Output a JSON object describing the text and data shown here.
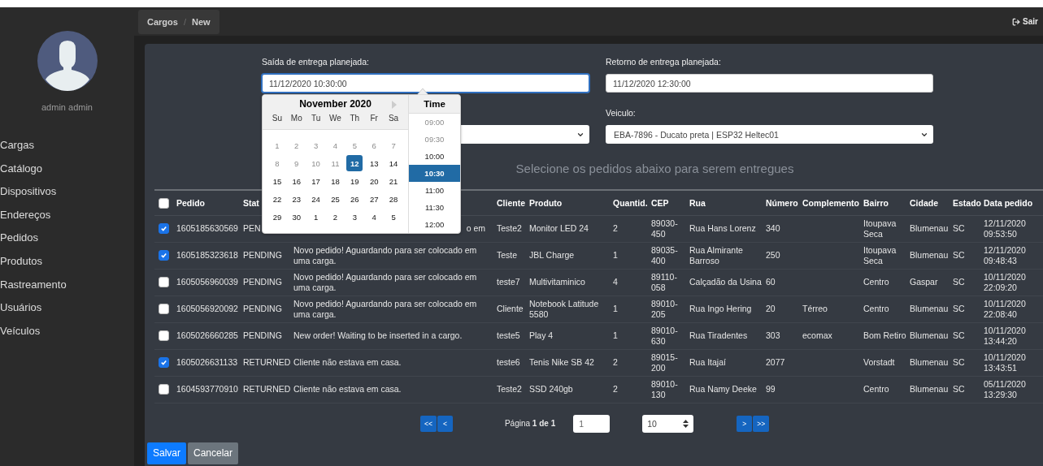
{
  "sidebar": {
    "user": "admin admin",
    "items": [
      "Cargas",
      "Catálogo",
      "Dispositivos",
      "Endereços",
      "Pedidos",
      "Produtos",
      "Rastreamento",
      "Usuários",
      "Veículos"
    ]
  },
  "topbar": {
    "breadcrumb": [
      "Cargos",
      "New"
    ],
    "separator": "/",
    "logout": "Sair"
  },
  "form": {
    "departure": {
      "label": "Saída de entrega planejada:",
      "value": "11/12/2020 10:30:00"
    },
    "return": {
      "label": "Retorno de entrega planejada:",
      "value": "11/12/2020 12:30:00"
    },
    "vehicle": {
      "label": "Veiculo:",
      "value": "EBA-7896 - Ducato preta | ESP32 Heltec01"
    }
  },
  "datepicker": {
    "month": "November 2020",
    "weekdays": [
      "Su",
      "Mo",
      "Tu",
      "We",
      "Th",
      "Fr",
      "Sa"
    ],
    "weeks": [
      [
        {
          "label": "1",
          "disabled": true,
          "selected": false
        },
        {
          "label": "2",
          "disabled": true,
          "selected": false
        },
        {
          "label": "3",
          "disabled": true,
          "selected": false
        },
        {
          "label": "4",
          "disabled": true,
          "selected": false
        },
        {
          "label": "5",
          "disabled": true,
          "selected": false
        },
        {
          "label": "6",
          "disabled": true,
          "selected": false
        },
        {
          "label": "7",
          "disabled": true,
          "selected": false
        }
      ],
      [
        {
          "label": "8",
          "disabled": true,
          "selected": false
        },
        {
          "label": "9",
          "disabled": true,
          "selected": false
        },
        {
          "label": "10",
          "disabled": true,
          "selected": false
        },
        {
          "label": "11",
          "disabled": true,
          "selected": false
        },
        {
          "label": "12",
          "disabled": false,
          "selected": true
        },
        {
          "label": "13",
          "disabled": false,
          "selected": false
        },
        {
          "label": "14",
          "disabled": false,
          "selected": false
        }
      ],
      [
        {
          "label": "15",
          "disabled": false,
          "selected": false
        },
        {
          "label": "16",
          "disabled": false,
          "selected": false
        },
        {
          "label": "17",
          "disabled": false,
          "selected": false
        },
        {
          "label": "18",
          "disabled": false,
          "selected": false
        },
        {
          "label": "19",
          "disabled": false,
          "selected": false
        },
        {
          "label": "20",
          "disabled": false,
          "selected": false
        },
        {
          "label": "21",
          "disabled": false,
          "selected": false
        }
      ],
      [
        {
          "label": "22",
          "disabled": false,
          "selected": false
        },
        {
          "label": "23",
          "disabled": false,
          "selected": false
        },
        {
          "label": "24",
          "disabled": false,
          "selected": false
        },
        {
          "label": "25",
          "disabled": false,
          "selected": false
        },
        {
          "label": "26",
          "disabled": false,
          "selected": false
        },
        {
          "label": "27",
          "disabled": false,
          "selected": false
        },
        {
          "label": "28",
          "disabled": false,
          "selected": false
        }
      ],
      [
        {
          "label": "29",
          "disabled": false,
          "selected": false
        },
        {
          "label": "30",
          "disabled": false,
          "selected": false
        },
        {
          "label": "1",
          "disabled": false,
          "selected": false
        },
        {
          "label": "2",
          "disabled": false,
          "selected": false
        },
        {
          "label": "3",
          "disabled": false,
          "selected": false
        },
        {
          "label": "4",
          "disabled": false,
          "selected": false
        },
        {
          "label": "5",
          "disabled": false,
          "selected": false
        }
      ]
    ],
    "time_title": "Time",
    "times": [
      {
        "label": "09:00",
        "disabled": true,
        "selected": false
      },
      {
        "label": "09:30",
        "disabled": true,
        "selected": false
      },
      {
        "label": "10:00",
        "disabled": false,
        "selected": false
      },
      {
        "label": "10:30",
        "disabled": false,
        "selected": true
      },
      {
        "label": "11:00",
        "disabled": false,
        "selected": false
      },
      {
        "label": "11:30",
        "disabled": false,
        "selected": false
      },
      {
        "label": "12:00",
        "disabled": false,
        "selected": false
      }
    ]
  },
  "instruction": "Selecione os pedidos abaixo para serem entregues",
  "table": {
    "header_checked": false,
    "columns": [
      "Pedido",
      "Stat",
      null,
      "Cliente",
      "Produto",
      "Quantid.",
      "CEP",
      "Rua",
      "Número",
      "Complemento",
      "Bairro",
      "Cidade",
      "Estado",
      "Data pedido"
    ],
    "rows": [
      {
        "checked": true,
        "covered": true,
        "cells": [
          "1605185630569",
          "PEN",
          "o em",
          "Teste2",
          "Monitor LED 24",
          "2",
          "89030-450",
          "Rua Hans Lorenz",
          "340",
          null,
          "Itoupava Seca",
          "Blumenau",
          "SC",
          "12/11/2020 09:53:50"
        ]
      },
      {
        "checked": true,
        "covered": false,
        "cells": [
          "1605185323618",
          "PENDING",
          "Novo pedido! Aguardando para ser colocado em uma carga.",
          "Teste",
          "JBL Charge",
          "1",
          "89035-400",
          "Rua Almirante Barroso",
          "250",
          null,
          "Itoupava Seca",
          "Blumenau",
          "SC",
          "12/11/2020 09:48:43"
        ]
      },
      {
        "checked": false,
        "covered": false,
        "cells": [
          "1605056960039",
          "PENDING",
          "Novo pedido! Aguardando para ser colocado em uma carga.",
          "teste7",
          "Multivitaminico",
          "4",
          "89110-058",
          "Calçadão da Usina",
          "60",
          null,
          "Centro",
          "Gaspar",
          "SC",
          "10/11/2020 22:09:20"
        ]
      },
      {
        "checked": false,
        "covered": false,
        "cells": [
          "1605056920092",
          "PENDING",
          "Novo pedido! Aguardando para ser colocado em uma carga.",
          "Cliente",
          "Notebook Latitude 5580",
          "1",
          "89010-205",
          "Rua Ingo Hering",
          "20",
          "Térreo",
          "Centro",
          "Blumenau",
          "SC",
          "10/11/2020 22:08:40"
        ]
      },
      {
        "checked": false,
        "covered": false,
        "cells": [
          "1605026660285",
          "PENDING",
          "New order! Waiting to be inserted in a cargo.",
          "teste5",
          "Play 4",
          "1",
          "89010-630",
          "Rua Tiradentes",
          "303",
          "ecomax",
          "Bom Retiro",
          "Blumenau",
          "SC",
          "10/11/2020 13:44:20"
        ]
      },
      {
        "checked": true,
        "covered": false,
        "cells": [
          "1605026631133",
          "RETURNED",
          "Cliente não estava em casa.",
          "teste6",
          "Tenis Nike SB 42",
          "2",
          "89015-200",
          "Rua Itajaí",
          "2077",
          null,
          "Vorstadt",
          "Blumenau",
          "SC",
          "10/11/2020 13:43:51"
        ]
      },
      {
        "checked": false,
        "covered": false,
        "cells": [
          "1604593770910",
          "RETURNED",
          "Cliente não estava em casa.",
          "Teste2",
          "SSD 240gb",
          "2",
          "89010-130",
          "Rua Namy Deeke",
          "99",
          null,
          "Centro",
          "Blumenau",
          "SC",
          "05/11/2020 13:29:30"
        ]
      }
    ]
  },
  "pagination": {
    "first": "<<",
    "prev": "<",
    "page_label": "Página **1 de 1**",
    "page_input": "1",
    "page_size": "10",
    "next": ">",
    "last": ">>"
  },
  "actions": [
    {
      "label": "Salvar",
      "kind": "primary"
    },
    {
      "label": "Cancelar",
      "kind": "secondary"
    }
  ]
}
